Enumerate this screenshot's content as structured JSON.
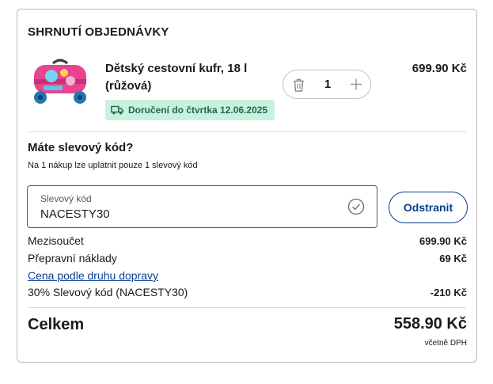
{
  "summary": {
    "title": "SHRNUTÍ OBJEDNÁVKY"
  },
  "product": {
    "name": "Dětský cestovní kufr, 18 l (růžová)",
    "delivery": "Doručení do čtvrtka 12.06.2025",
    "quantity": "1",
    "price": "699.90 Kč"
  },
  "coupon": {
    "question": "Máte slevový kód?",
    "note": "Na 1 nákup lze uplatnit pouze 1 slevový kód",
    "field_label": "Slevový kód",
    "field_value": "NACESTY30",
    "remove_label": "Odstranit"
  },
  "lines": {
    "subtotal_label": "Mezisoučet",
    "subtotal_value": "699.90 Kč",
    "shipping_label": "Přepravní náklady",
    "shipping_value": "69 Kč",
    "shipping_link": "Cena podle druhu dopravy",
    "discount_label": "30% Slevový kód (NACESTY30)",
    "discount_value": "-210 Kč"
  },
  "total": {
    "label": "Celkem",
    "value": "558.90 Kč",
    "vat_note": "včetně DPH"
  },
  "colors": {
    "accent": "#0b3d91",
    "delivery_bg": "#c9f1df",
    "delivery_text": "#1b6b45",
    "suitcase": "#e7458f"
  }
}
